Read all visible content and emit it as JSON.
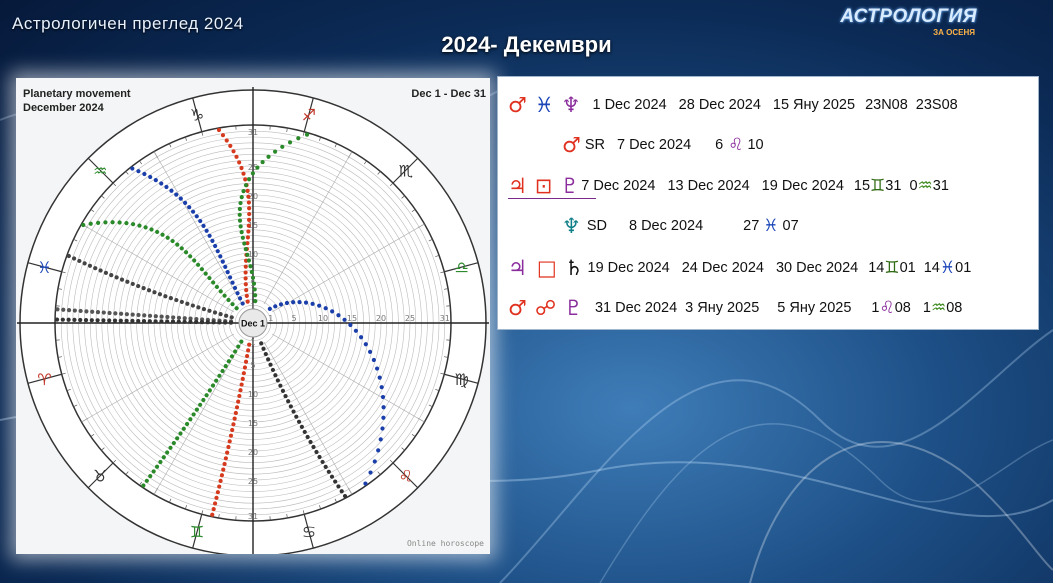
{
  "header": {
    "top_left_title": "Астрологичен преглед 2024",
    "main_title": "2024- Декември",
    "logo_text": "АСТРОЛОГИЯ",
    "logo_sub": "ЗА ОСЕНЯ"
  },
  "chart": {
    "caption_line1": "Planetary movement",
    "caption_line2": "December 2024",
    "date_range": "Dec 1 - Dec 31",
    "center_label": "Dec 1",
    "footer": "Online horoscope",
    "zodiac_signs": [
      "♑",
      "♐",
      "♏",
      "♎",
      "♍",
      "♌",
      "♋",
      "♊",
      "♉",
      "♈",
      "♓",
      "♒"
    ],
    "ring_labels": [
      "1",
      "5",
      "10",
      "15",
      "20",
      "25",
      "31"
    ]
  },
  "transits": [
    {
      "symbols": [
        {
          "g": "♂",
          "c": "red"
        },
        {
          "g": "♓",
          "c": "blue"
        },
        {
          "g": "♆",
          "c": "purple"
        }
      ],
      "texts": [
        "1 Dec 2024",
        "28 Dec 2024",
        "15 Яну 2025",
        "23N08",
        "23S08"
      ]
    },
    {
      "symbols": [
        {
          "g": "♂",
          "c": "red"
        }
      ],
      "texts": [
        "SR",
        "7 Dec 2024",
        "6",
        "10"
      ],
      "inline_sign": {
        "g": "♌",
        "c": "purple"
      }
    },
    {
      "symbols": [
        {
          "g": "♃",
          "c": "red"
        },
        {
          "g": "⊡",
          "c": "red"
        },
        {
          "g": "♇",
          "c": "purple"
        }
      ],
      "texts": [
        "7 Dec 2024",
        "13 Dec 2024",
        "19 Dec 2024",
        "15",
        "31",
        "0",
        "31"
      ],
      "signs": [
        {
          "g": "♊",
          "c": "darkgreen"
        },
        {
          "g": "♒",
          "c": "green"
        }
      ]
    },
    {
      "symbols": [
        {
          "g": "♆",
          "c": "teal"
        }
      ],
      "texts": [
        "SD",
        "8 Dec 2024",
        "27",
        "07"
      ],
      "inline_sign": {
        "g": "♓",
        "c": "blue"
      }
    },
    {
      "symbols": [
        {
          "g": "♃",
          "c": "purple"
        },
        {
          "g": "□",
          "c": "red"
        },
        {
          "g": "♄",
          "c": "black"
        }
      ],
      "texts": [
        "19 Dec 2024",
        "24 Dec 2024",
        "30 Dec 2024",
        "14",
        "01",
        "14",
        "01"
      ],
      "signs": [
        {
          "g": "♊",
          "c": "darkgreen"
        },
        {
          "g": "♓",
          "c": "blue"
        }
      ]
    },
    {
      "symbols": [
        {
          "g": "♂",
          "c": "red"
        },
        {
          "g": "☍",
          "c": "red"
        },
        {
          "g": "♇",
          "c": "purple"
        }
      ],
      "texts": [
        "31 Dec 2024",
        "3 Яну 2025",
        "5 Яну 2025",
        "1",
        "08",
        "1",
        "08"
      ],
      "signs": [
        {
          "g": "♌",
          "c": "purple"
        },
        {
          "g": "♒",
          "c": "green"
        }
      ]
    }
  ]
}
